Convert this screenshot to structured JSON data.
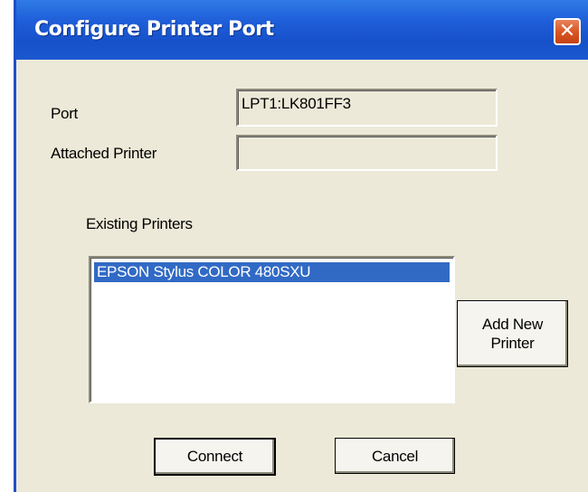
{
  "dialog": {
    "title": "Configure Printer Port",
    "close_glyph": "✕"
  },
  "port": {
    "label": "Port",
    "value": "LPT1:LK801FF3"
  },
  "attached_printer": {
    "label": "Attached Printer",
    "value": ""
  },
  "existing_printers": {
    "label": "Existing Printers",
    "items": [
      "EPSON Stylus COLOR 480SXU"
    ],
    "selected_index": 0
  },
  "buttons": {
    "add_new_printer_line1": "Add New",
    "add_new_printer_line2": "Printer",
    "connect": "Connect",
    "cancel": "Cancel"
  },
  "colors": {
    "titlebar": "#1f5ed9",
    "selection": "#316ac5",
    "close": "#d9531f",
    "face": "#ece9d8"
  }
}
